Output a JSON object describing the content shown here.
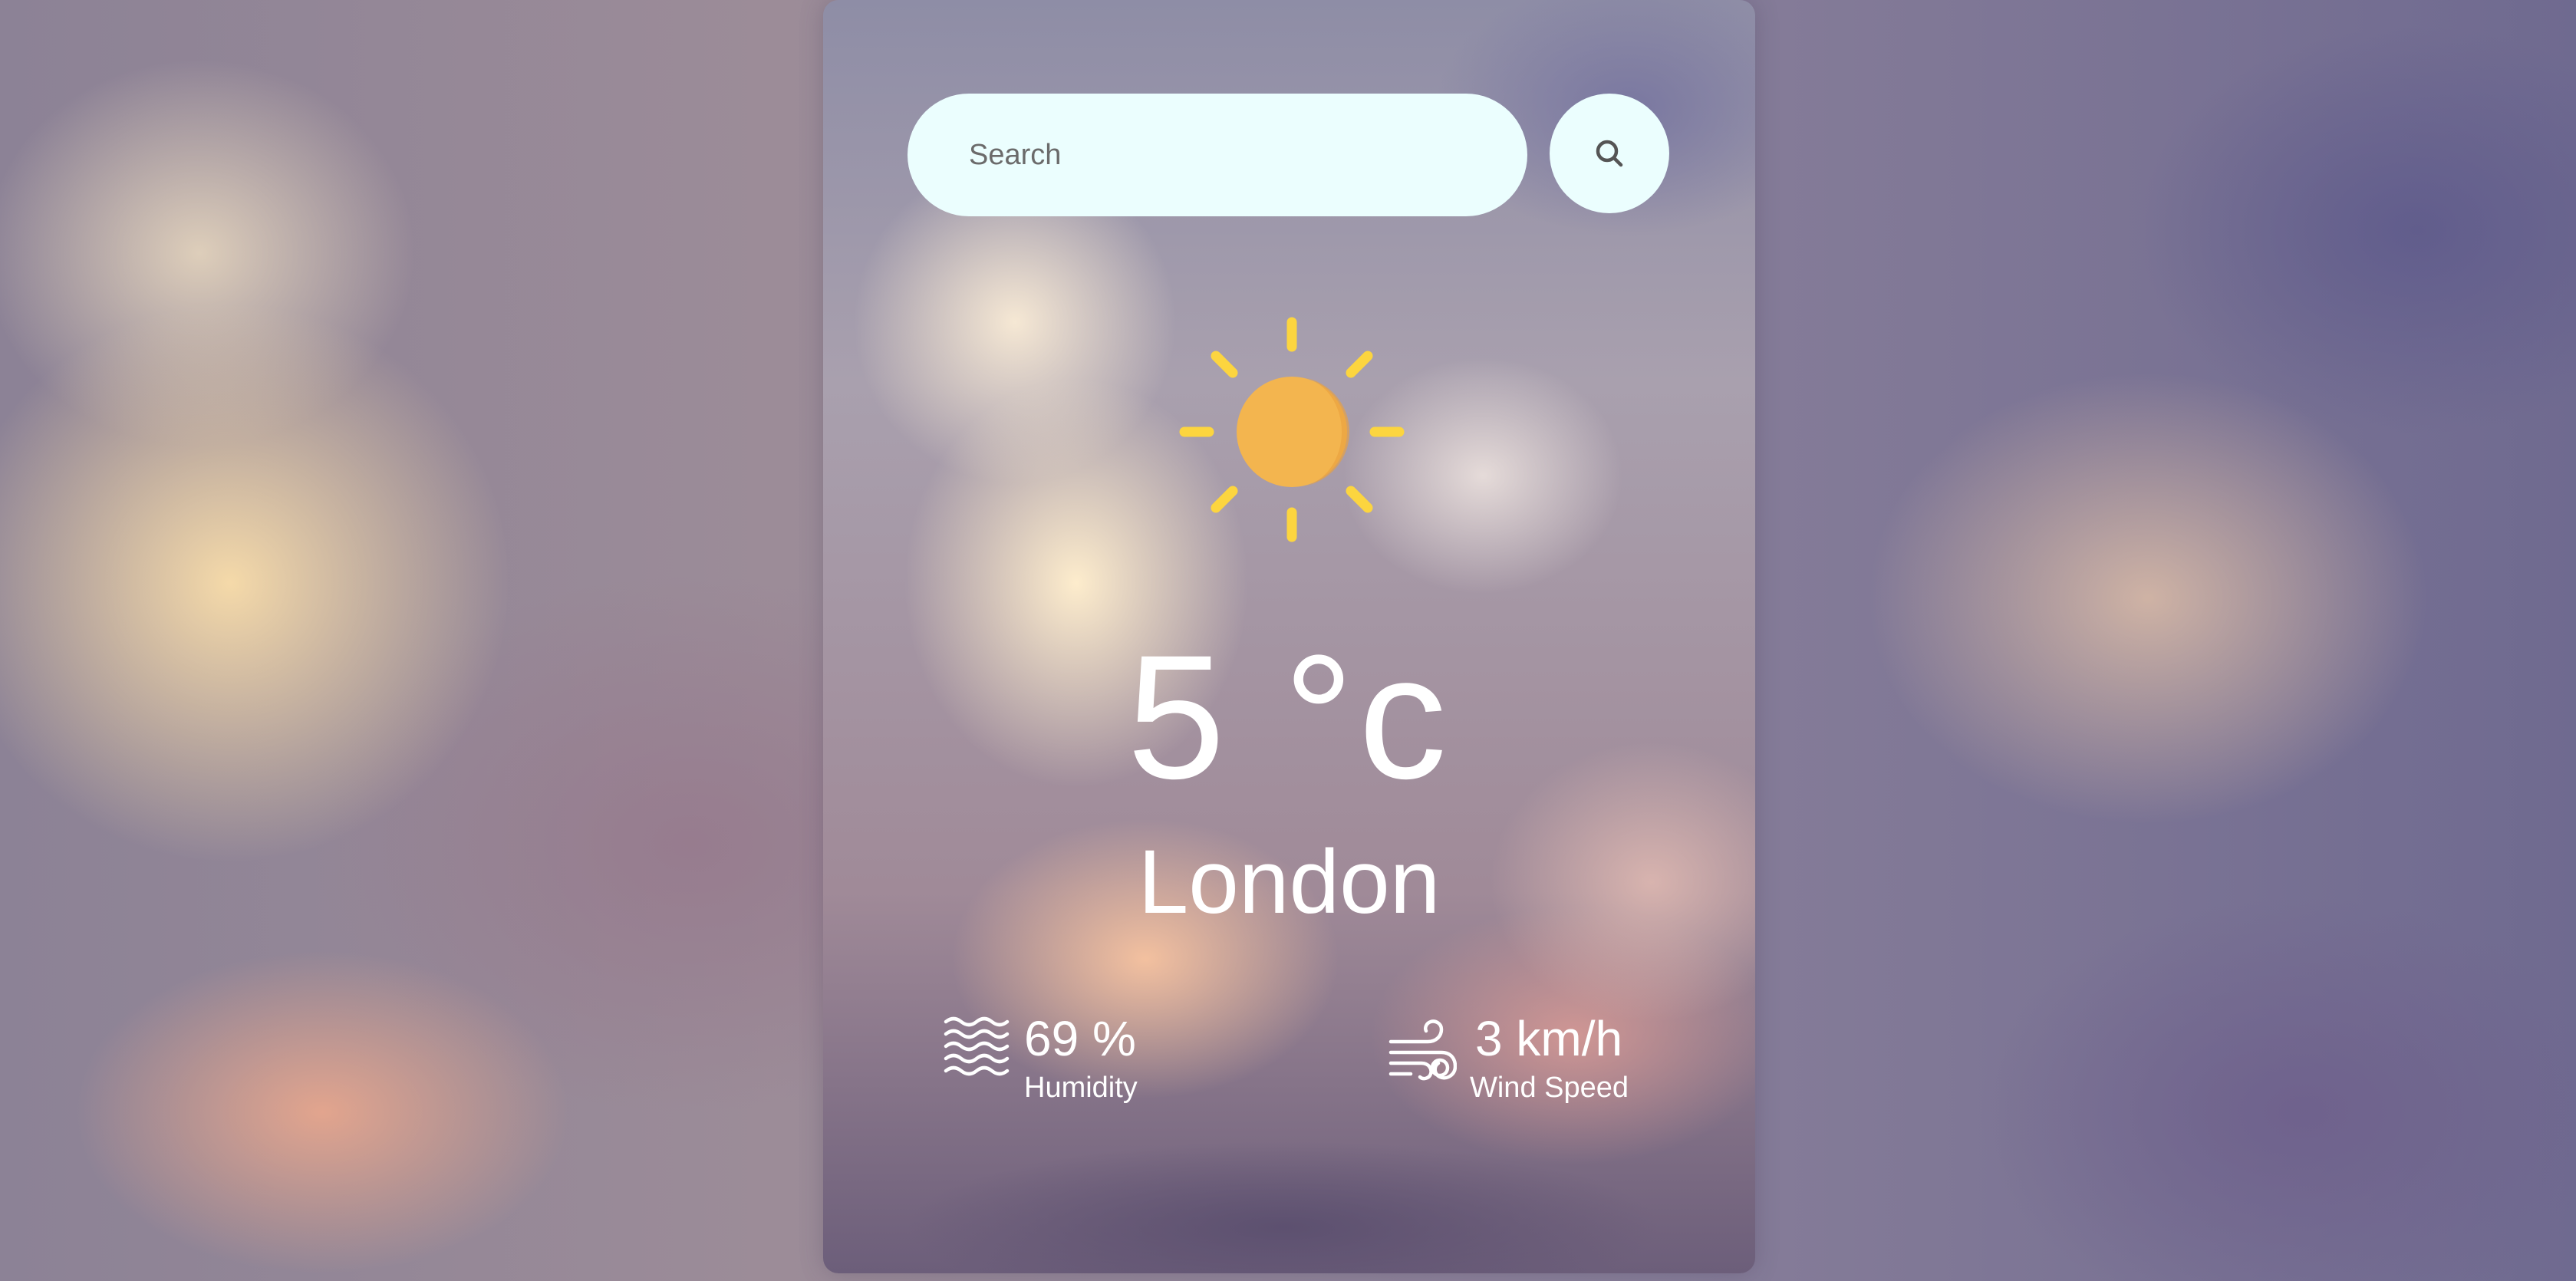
{
  "search": {
    "placeholder": "Search",
    "button_icon": "search-icon"
  },
  "weather": {
    "icon": "sun-icon",
    "temperature": "5 °c",
    "city": "London"
  },
  "details": {
    "humidity": {
      "icon": "humidity-icon",
      "value": "69 %",
      "label": "Humidity"
    },
    "wind": {
      "icon": "wind-icon",
      "value": "3 km/h",
      "label": "Wind Speed"
    }
  },
  "colors": {
    "input_background": "#ebfefe",
    "sun_core": "#f3b54f",
    "sun_rays": "#fcd53f",
    "text": "#ffffff"
  }
}
